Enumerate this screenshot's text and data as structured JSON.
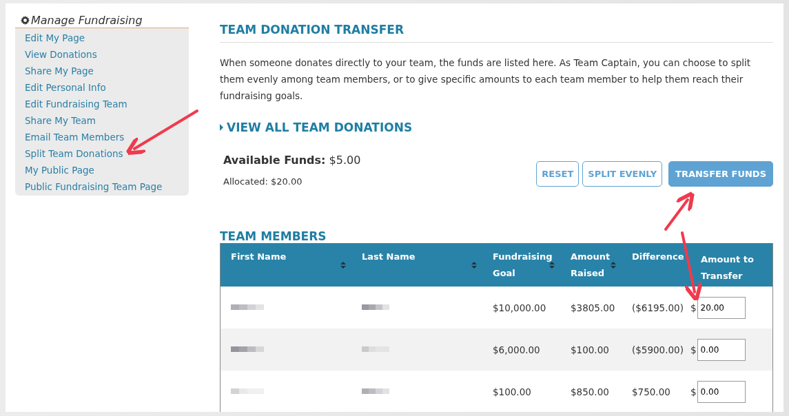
{
  "sidebar": {
    "title": "Manage Fundraising",
    "items": [
      {
        "label": "Edit My Page"
      },
      {
        "label": "View Donations"
      },
      {
        "label": "Share My Page"
      },
      {
        "label": "Edit Personal Info"
      },
      {
        "label": "Edit Fundraising Team"
      },
      {
        "label": "Share My Team"
      },
      {
        "label": "Email Team Members"
      },
      {
        "label": "Split Team Donations"
      },
      {
        "label": "My Public Page"
      },
      {
        "label": "Public Fundraising Team Page"
      }
    ]
  },
  "main": {
    "title": "TEAM DONATION TRANSFER",
    "intro": "When someone donates directly to your team, the funds are listed here. As Team Captain, you can choose to split them evenly among team members, or to give specific amounts to each team member to help them reach their fundraising goals.",
    "toggle": {
      "label": "VIEW ALL TEAM DONATIONS",
      "expanded": false
    },
    "available_label": "Available Funds:",
    "available_value": "$5.00",
    "allocated": "Allocated: $20.00",
    "buttons": [
      {
        "label": "RESET",
        "kind": "outline"
      },
      {
        "label": "SPLIT EVENLY",
        "kind": "outline"
      },
      {
        "label": "TRANSFER FUNDS",
        "kind": "primary"
      }
    ],
    "members_title": "TEAM MEMBERS",
    "table": {
      "columns": [
        {
          "label": "First Name",
          "sortable": true
        },
        {
          "label": "Last Name",
          "sortable": true
        },
        {
          "label": "Fundraising Goal",
          "sortable": true
        },
        {
          "label": "Amount Raised",
          "sortable": true
        },
        {
          "label": "Difference",
          "sortable": false
        },
        {
          "label": "Amount to Transfer",
          "sortable": false
        }
      ],
      "rows": [
        {
          "goal": "$10,000.00",
          "raised": "$3805.00",
          "difference": "($6195.00)",
          "currency": "$",
          "amount": "20.00"
        },
        {
          "goal": "$6,000.00",
          "raised": "$100.00",
          "difference": "($5900.00)",
          "currency": "$",
          "amount": "0.00"
        },
        {
          "goal": "$100.00",
          "raised": "$850.00",
          "difference": "$750.00",
          "currency": "$",
          "amount": "0.00"
        }
      ]
    }
  }
}
